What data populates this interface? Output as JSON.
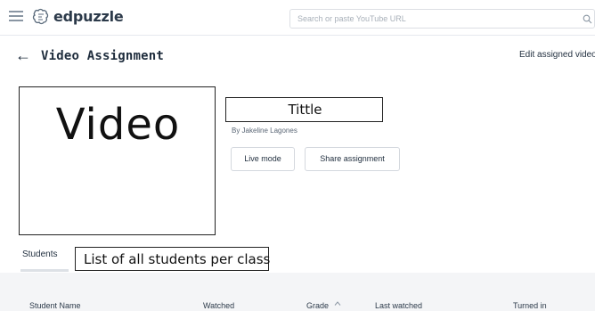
{
  "header": {
    "brand": "edpuzzle",
    "search_placeholder": "Search or paste YouTube URL"
  },
  "page": {
    "title": "Video Assignment",
    "edit_link": "Edit assigned video"
  },
  "assignment": {
    "video_label": "Video",
    "title": "Tittle",
    "author": "By Jakeline Lagones",
    "live_mode_label": "Live mode",
    "share_label": "Share assignment"
  },
  "tabs": {
    "students": "Students",
    "students_note": "List of all students per class"
  },
  "table": {
    "columns": [
      "Student Name",
      "Watched",
      "Grade",
      "Last watched",
      "Turned in"
    ]
  },
  "colors": {
    "text": "#1f2d3d",
    "border": "#dcdfe4",
    "table_bg": "#f4f5f7"
  }
}
